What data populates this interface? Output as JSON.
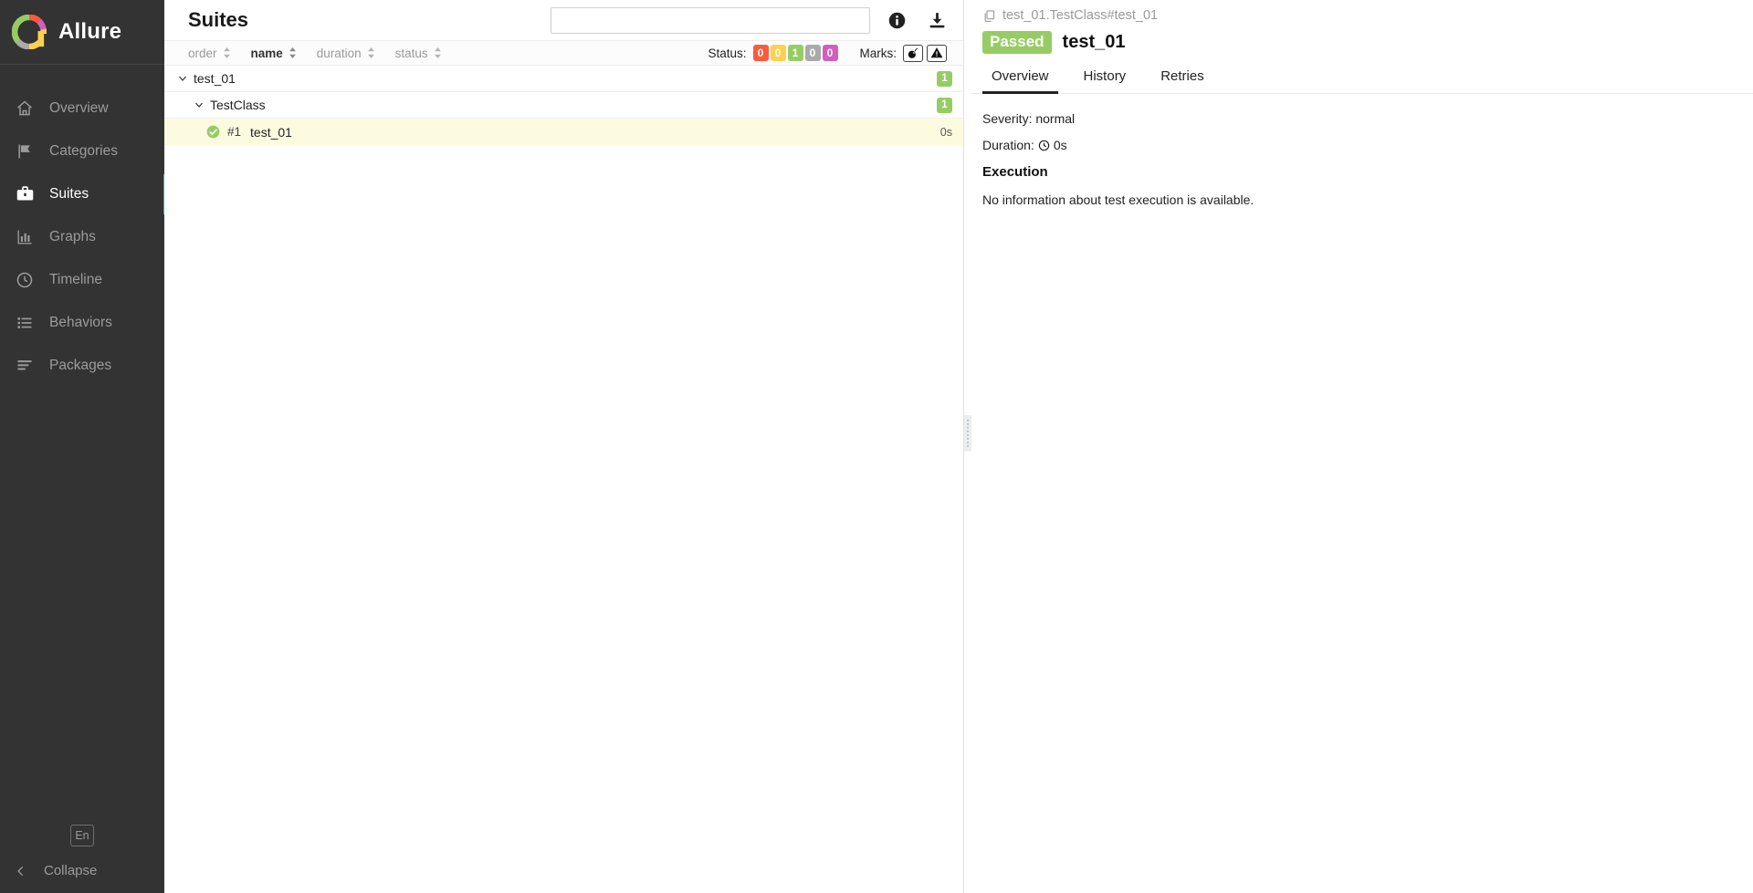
{
  "brand": {
    "name": "Allure",
    "logo_icon": "allure-donut-logo"
  },
  "sidebar": {
    "items": [
      {
        "label": "Overview",
        "icon": "home-icon",
        "active": false
      },
      {
        "label": "Categories",
        "icon": "flag-icon",
        "active": false
      },
      {
        "label": "Suites",
        "icon": "suitcase-icon",
        "active": true
      },
      {
        "label": "Graphs",
        "icon": "bar-chart-icon",
        "active": false
      },
      {
        "label": "Timeline",
        "icon": "clock-icon",
        "active": false
      },
      {
        "label": "Behaviors",
        "icon": "list-icon",
        "active": false
      },
      {
        "label": "Packages",
        "icon": "layers-icon",
        "active": false
      }
    ],
    "language_button": "En",
    "collapse_label": "Collapse",
    "collapse_icon": "chevron-left-icon",
    "active_accent": "#4aa3df"
  },
  "header": {
    "title": "Suites",
    "search_value": "",
    "search_placeholder": "",
    "info_icon": "info-icon",
    "download_icon": "download-icon"
  },
  "sort_bar": {
    "columns": [
      {
        "label": "order",
        "active": false
      },
      {
        "label": "name",
        "active": true
      },
      {
        "label": "duration",
        "active": false
      },
      {
        "label": "status",
        "active": false
      }
    ],
    "status_label": "Status:",
    "status_chips": [
      {
        "value": "0",
        "name": "failed",
        "color": "#fd5a3e"
      },
      {
        "value": "0",
        "name": "broken",
        "color": "#ffd050"
      },
      {
        "value": "1",
        "name": "passed",
        "color": "#97cc64"
      },
      {
        "value": "0",
        "name": "skipped",
        "color": "#aaaaaa"
      },
      {
        "value": "0",
        "name": "unknown",
        "color": "#d35ebe"
      }
    ],
    "marks_label": "Marks:",
    "marks": [
      {
        "name": "flaky-bomb-icon"
      },
      {
        "name": "warning-triangle-icon"
      }
    ]
  },
  "tree": {
    "rows": [
      {
        "level": 1,
        "label": "test_01",
        "badge": "1",
        "badge_type": "count",
        "expanded": true,
        "selected": false,
        "status": null
      },
      {
        "level": 2,
        "label": "TestClass",
        "badge": "1",
        "badge_type": "count",
        "expanded": true,
        "selected": false,
        "status": null
      },
      {
        "level": 3,
        "label": "test_01",
        "badge": "0s",
        "badge_type": "duration",
        "expanded": null,
        "selected": true,
        "status": "passed",
        "case_number": "#1"
      }
    ]
  },
  "details": {
    "breadcrumb": "test_01.TestClass#test_01",
    "breadcrumb_icon": "copy-icon",
    "status": "Passed",
    "status_color": "#97cc64",
    "title": "test_01",
    "tabs": [
      {
        "label": "Overview",
        "active": true
      },
      {
        "label": "History",
        "active": false
      },
      {
        "label": "Retries",
        "active": false
      }
    ],
    "severity_line": "Severity: normal",
    "duration_label": "Duration:",
    "duration_value": "0s",
    "duration_icon": "clock-icon",
    "execution_title": "Execution",
    "execution_note": "No information about test execution is available."
  }
}
